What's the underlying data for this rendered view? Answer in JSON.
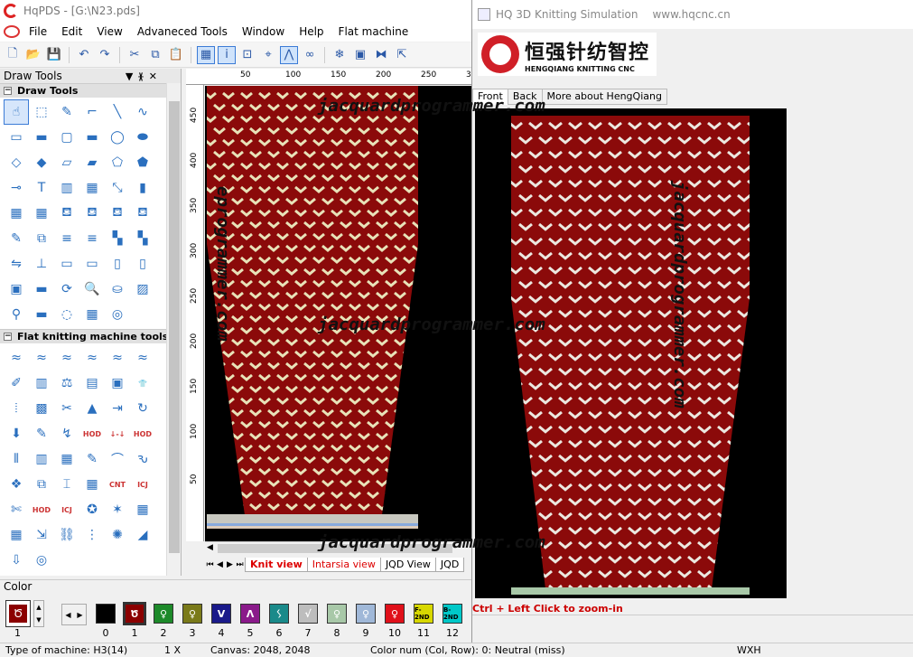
{
  "main_window": {
    "title": "HqPDS - [G:\\N23.pds]",
    "menu": [
      "File",
      "Edit",
      "View",
      "Advaneced Tools",
      "Window",
      "Help",
      "Flat machine"
    ]
  },
  "draw_tools_panel": {
    "header": "Draw Tools",
    "header_buttons": [
      "▼",
      "ᚕ",
      "✕"
    ],
    "section_draw": "Draw Tools",
    "section_flat": "Flat knitting machine tools",
    "draw_icons": [
      "hand-icon",
      "select-rect-icon",
      "pencil-icon",
      "step-line-icon",
      "line-icon",
      "curve-icon",
      "rect-outline-icon",
      "rect-fill-icon",
      "round-rect-outline-icon",
      "round-rect-fill-icon",
      "ellipse-outline-icon",
      "ellipse-fill-icon",
      "diamond-outline-icon",
      "diamond-fill-icon",
      "parallelogram-outline-icon",
      "parallelogram-fill-icon",
      "polygon-outline-icon",
      "polygon-fill-icon",
      "dropper-icon",
      "text-icon",
      "columns-icon",
      "grid-icon",
      "diagonal-icon",
      "bars-icon",
      "grid-small-icon",
      "grid-large-icon",
      "bucket-icon",
      "bucket2-icon",
      "bucket3-icon",
      "bucket4-icon",
      "brush-icon",
      "copy-icon",
      "align-icon",
      "align2-icon",
      "dist-icon",
      "dist2-icon",
      "connect-icon",
      "tree-icon",
      "window-icon",
      "monitor-icon",
      "page-icon",
      "page2-icon",
      "frame-icon",
      "eraser-icon",
      "rotate-icon",
      "zoom-icon",
      "stamp-icon",
      "picture-icon",
      "wand-icon",
      "clear-icon",
      "lasso-icon",
      "tiles-icon",
      "spiral-icon"
    ],
    "flat_icons": [
      "stitch1-icon",
      "stitch2-icon",
      "stitch3-icon",
      "stitch4-icon",
      "stitch5-icon",
      "stitch6-icon",
      "pen-color-icon",
      "save-icon",
      "scale-icon",
      "film-icon",
      "box-icon",
      "shirt-icon",
      "bars3-icon",
      "red-grid-icon",
      "tools-icon",
      "triangle-icon",
      "export-icon",
      "redo-icon",
      "down-icon",
      "brush2-icon",
      "link-icon",
      "hod-icon",
      "down-up-icon",
      "hod2-icon",
      "stripes-icon",
      "color-strip-icon",
      "fabric-icon",
      "pen2-icon",
      "bowl-icon",
      "knot-icon",
      "pattern-icon",
      "repeat-icon",
      "ibeam-icon",
      "red-grid2-icon",
      "cnt-icon",
      "icj-icon",
      "cut-icon",
      "hod3-icon",
      "icj2-icon",
      "sweater-icon",
      "star-icon",
      "palette-icon",
      "chart-icon",
      "arrow-icon",
      "chain-icon",
      "dots-icon",
      "glow-icon",
      "ramp-icon",
      "down-arrow-icon",
      "spiral2-icon"
    ],
    "flat_labels": {
      "hod": "HOD",
      "cnt": "CNT",
      "icj": "ICJ",
      "down_up": "↓-↓"
    }
  },
  "ruler": {
    "top_ticks": [
      "50",
      "100",
      "150",
      "200",
      "250",
      "30"
    ],
    "left_ticks": [
      "450",
      "400",
      "350",
      "300",
      "250",
      "200",
      "150",
      "100",
      "50"
    ]
  },
  "view_tabs": [
    "Knit view",
    "Intarsia view",
    "JQD View",
    "JQD"
  ],
  "color_panel": {
    "header": "Color",
    "current_index": "1",
    "swatches": [
      {
        "num": "0",
        "color": "#000000",
        "glyph": ""
      },
      {
        "num": "1",
        "color": "#8b0000",
        "glyph": "Ծ"
      },
      {
        "num": "2",
        "color": "#1d8a2a",
        "glyph": "♀"
      },
      {
        "num": "3",
        "color": "#7a7a1a",
        "glyph": "♀"
      },
      {
        "num": "4",
        "color": "#1a1a8a",
        "glyph": "V"
      },
      {
        "num": "5",
        "color": "#8a1a8a",
        "glyph": "Λ"
      },
      {
        "num": "6",
        "color": "#1a8a8a",
        "glyph": "ᛊ"
      },
      {
        "num": "7",
        "color": "#bdbdbd",
        "glyph": "√"
      },
      {
        "num": "8",
        "color": "#a8c8a8",
        "glyph": "♀"
      },
      {
        "num": "9",
        "color": "#a0b8d8",
        "glyph": "♀"
      },
      {
        "num": "10",
        "color": "#e0101a",
        "glyph": "♀"
      },
      {
        "num": "11",
        "color": "#d8d800",
        "glyph": "F-2ND"
      },
      {
        "num": "12",
        "color": "#00c8c8",
        "glyph": "B-2ND"
      }
    ]
  },
  "status": {
    "machine": "Type of machine: H3(14)",
    "zoom": "1 X",
    "canvas": "Canvas: 2048, 2048",
    "color_num": "Color num  (Col, Row): 0: Neutral (miss)",
    "wxh": "WXH"
  },
  "sim_window": {
    "title": "HQ 3D Knitting Simulation",
    "url": "www.hqcnc.cn",
    "logo_cn": "恒强针纺智控",
    "logo_en": "HENGQIANG KNITTING CNC",
    "tabs": [
      "Front",
      "Back",
      "More about HengQiang"
    ],
    "hint": "Ctrl + Left Click to zoom-in"
  },
  "watermarks": {
    "text": "jacquardprogrammer.com",
    "left_vertical": "eprogrammer.com"
  },
  "colors": {
    "fabric": "#8b0a0a",
    "chevron": "#e8e2b8",
    "sim_chevron": "#ece8e0",
    "canvas_bg": "#000000"
  }
}
